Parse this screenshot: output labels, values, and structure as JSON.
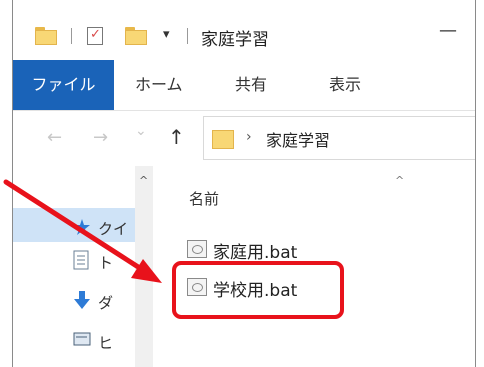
{
  "window": {
    "title": "家庭学習",
    "dropdown_glyph": "▾",
    "minimize_glyph": "—"
  },
  "ribbon": {
    "tabs": [
      "ファイル",
      "ホーム",
      "共有",
      "表示"
    ]
  },
  "navigation": {
    "back_glyph": "←",
    "forward_glyph": "→",
    "recent_glyph": "⌄",
    "up_glyph": "↑",
    "breadcrumb_chevron": "›",
    "address_text": "家庭学習"
  },
  "nav_pane": {
    "scroll_up_glyph": "^",
    "items": [
      {
        "icon": "star-icon",
        "label": "クイ"
      },
      {
        "icon": "document-icon",
        "label": "ト"
      },
      {
        "icon": "download-icon",
        "label": "ダ"
      },
      {
        "icon": "desktop-icon",
        "label": "ヒ"
      }
    ]
  },
  "file_list": {
    "column_header": "名前",
    "sort_glyph": "^",
    "files": [
      {
        "name": "家庭用.bat",
        "icon": "batch-file-icon"
      },
      {
        "name": "学校用.bat",
        "icon": "batch-file-icon"
      }
    ]
  },
  "annotation": {
    "highlight_color": "#e8121b",
    "arrow_color": "#e8121b"
  },
  "colors": {
    "file_tab": "#1a63b8",
    "folder": "#f8d775",
    "selection": "#cfe3f7"
  }
}
